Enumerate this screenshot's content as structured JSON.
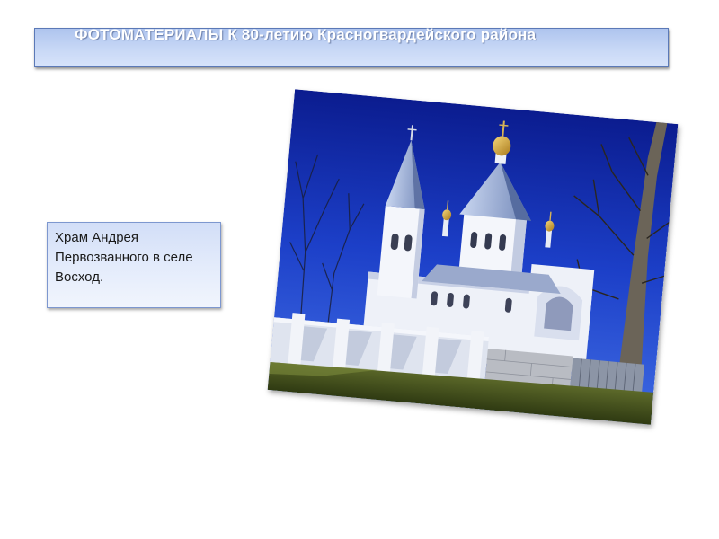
{
  "slide": {
    "title": "ФОТОМАТЕРИАЛЫ  К  80-летию  Красногвардейского района",
    "caption": "Храм Андрея Первозванного в селе  Восход."
  },
  "photo": {
    "subject": "church-photo"
  }
}
